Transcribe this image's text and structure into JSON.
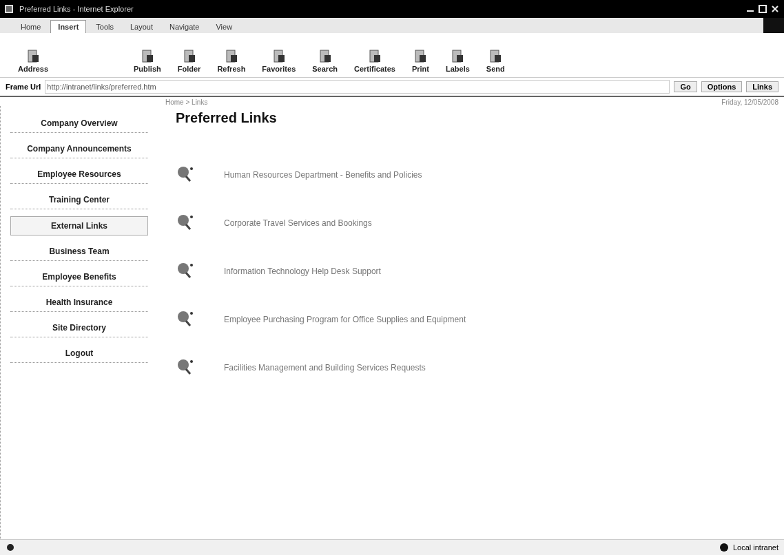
{
  "window": {
    "title": "Preferred Links - Internet Explorer"
  },
  "tabs": [
    {
      "label": "Home",
      "selected": false
    },
    {
      "label": "Insert",
      "selected": true
    },
    {
      "label": "Tools",
      "selected": false
    },
    {
      "label": "Layout",
      "selected": false
    },
    {
      "label": "Navigate",
      "selected": false
    },
    {
      "label": "View",
      "selected": false
    }
  ],
  "ribbon": [
    {
      "label": "Address",
      "kind": "small"
    },
    {
      "label": "Publish",
      "kind": "big"
    },
    {
      "label": "Folder",
      "kind": "big"
    },
    {
      "label": "Refresh",
      "kind": "big"
    },
    {
      "label": "Favorites",
      "kind": "big"
    },
    {
      "label": "Search",
      "kind": "big"
    },
    {
      "label": "Certificates",
      "kind": "big"
    },
    {
      "label": "Print",
      "kind": "big"
    },
    {
      "label": "Labels",
      "kind": "big"
    },
    {
      "label": "Send",
      "kind": "big"
    }
  ],
  "address": {
    "label": "Frame Url",
    "value": "http://intranet/links/preferred.htm",
    "buttons": [
      "Go",
      "Options",
      "Links"
    ]
  },
  "breadcrumb": "Home > Links",
  "date": "Friday, 12/05/2008",
  "sidebar": [
    {
      "label": "Company Overview",
      "selected": false
    },
    {
      "label": "Company Announcements",
      "selected": false
    },
    {
      "label": "Employee Resources",
      "selected": false
    },
    {
      "label": "Training Center",
      "selected": false
    },
    {
      "label": "External Links",
      "selected": true
    },
    {
      "label": "Business Team",
      "selected": false
    },
    {
      "label": "Employee Benefits",
      "selected": false
    },
    {
      "label": "Health Insurance",
      "selected": false
    },
    {
      "label": "Site Directory",
      "selected": false
    },
    {
      "label": "Logout",
      "selected": false
    }
  ],
  "heading": "Preferred Links",
  "links": [
    "Human Resources Department - Benefits and Policies",
    "Corporate Travel Services and Bookings",
    "Information Technology Help Desk Support",
    "Employee Purchasing Program for Office Supplies and Equipment",
    "Facilities Management and Building Services Requests"
  ],
  "status": {
    "zone": "Local intranet"
  }
}
